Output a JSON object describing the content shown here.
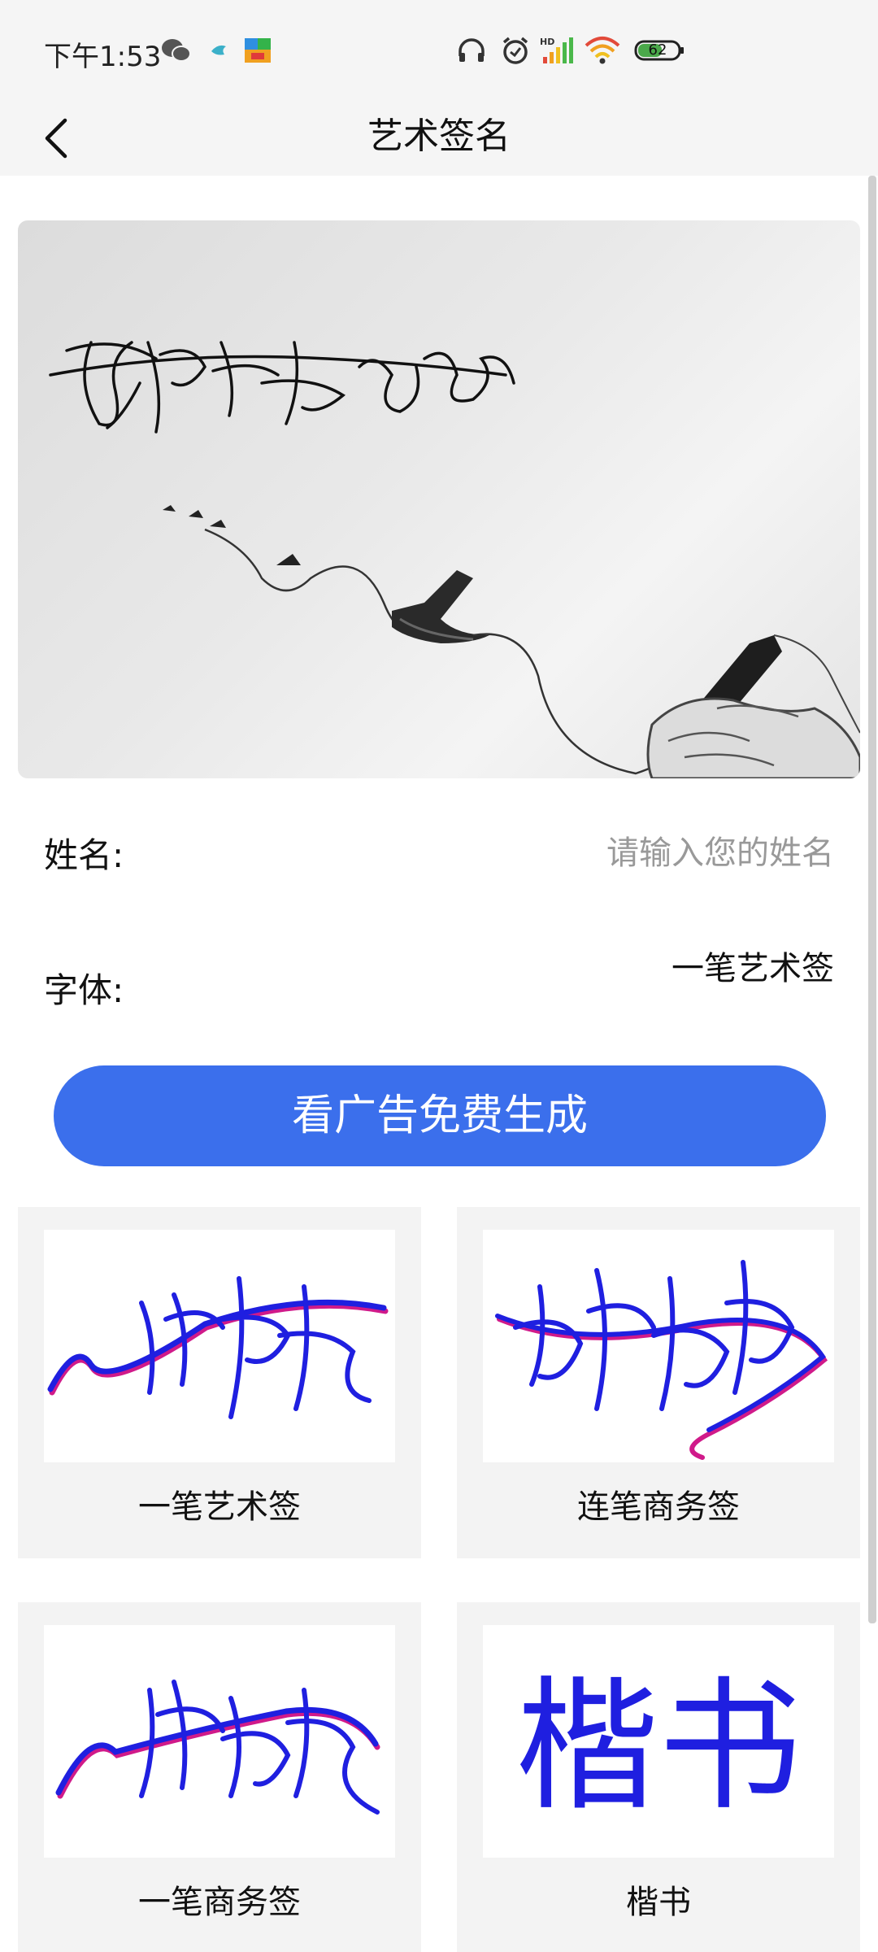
{
  "status_bar": {
    "time": "下午1:53",
    "battery": "62",
    "icons": [
      "wechat-icon",
      "bird-icon",
      "app-icon",
      "headphones-icon",
      "alarm-icon",
      "signal-icon",
      "wifi-icon",
      "battery-icon"
    ]
  },
  "header": {
    "back_icon": "chevron-left-icon",
    "title": "艺术签名"
  },
  "form": {
    "name_label": "姓名:",
    "name_placeholder": "请输入您的姓名",
    "name_value": "",
    "font_label": "字体:",
    "font_value": "一笔艺术签"
  },
  "generate_button": "看广告免费生成",
  "styles": [
    {
      "label": "一笔艺术签",
      "preview": "一笔艺术签"
    },
    {
      "label": "连笔商务签",
      "preview": "连笔商务签"
    },
    {
      "label": "一笔商务签",
      "preview": "一笔商务签"
    },
    {
      "label": "楷书",
      "preview": "楷书"
    }
  ],
  "colors": {
    "accent": "#3b6fec",
    "header_bg": "#f5f5f5",
    "signature_blue": "#1f1fe0",
    "signature_magenta": "#d01a8a"
  }
}
